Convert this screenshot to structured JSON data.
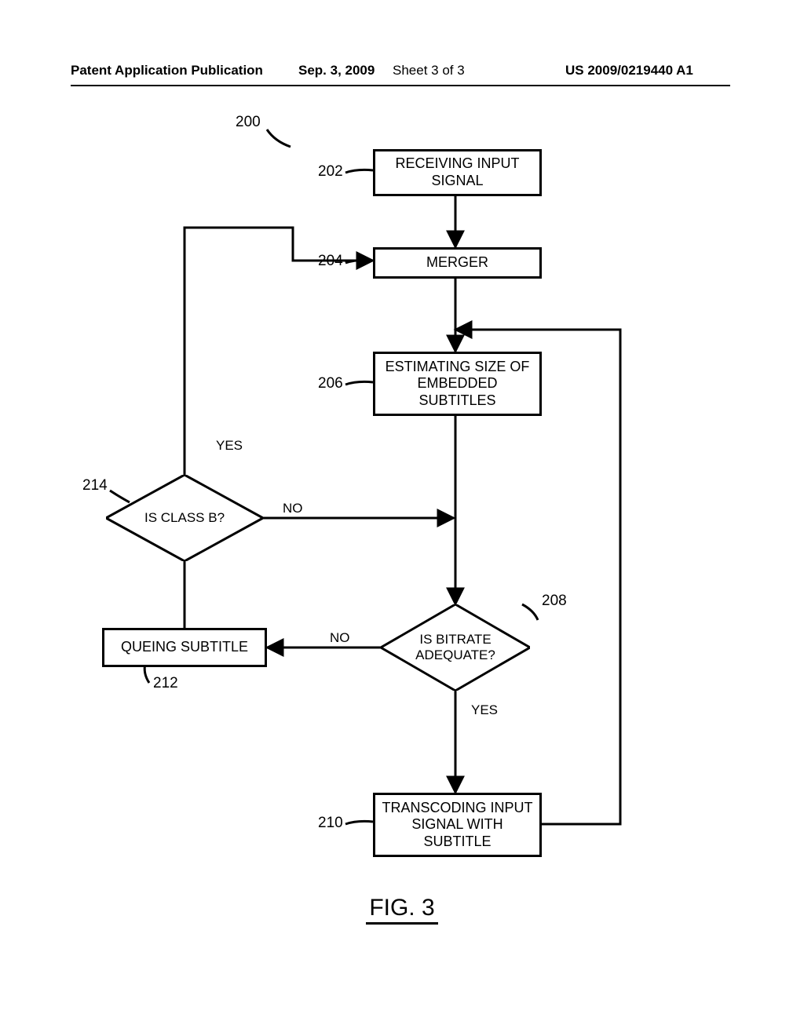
{
  "header": {
    "left": "Patent Application Publication",
    "date": "Sep. 3, 2009",
    "sheet": "Sheet 3 of 3",
    "docnum": "US 2009/0219440 A1"
  },
  "refs": {
    "main": "200",
    "r202": "202",
    "r204": "204",
    "r206": "206",
    "r208": "208",
    "r210": "210",
    "r212": "212",
    "r214": "214"
  },
  "labels": {
    "yes": "YES",
    "no": "NO"
  },
  "boxes": {
    "b202": "RECEIVING INPUT SIGNAL",
    "b204": "MERGER",
    "b206": "ESTIMATING SIZE OF EMBEDDED SUBTITLES",
    "b210": "TRANSCODING INPUT SIGNAL WITH SUBTITLE",
    "b212": "QUEING SUBTITLE"
  },
  "decisions": {
    "d208": "IS BITRATE ADEQUATE?",
    "d214": "IS CLASS B?"
  },
  "figure": "FIG. 3"
}
